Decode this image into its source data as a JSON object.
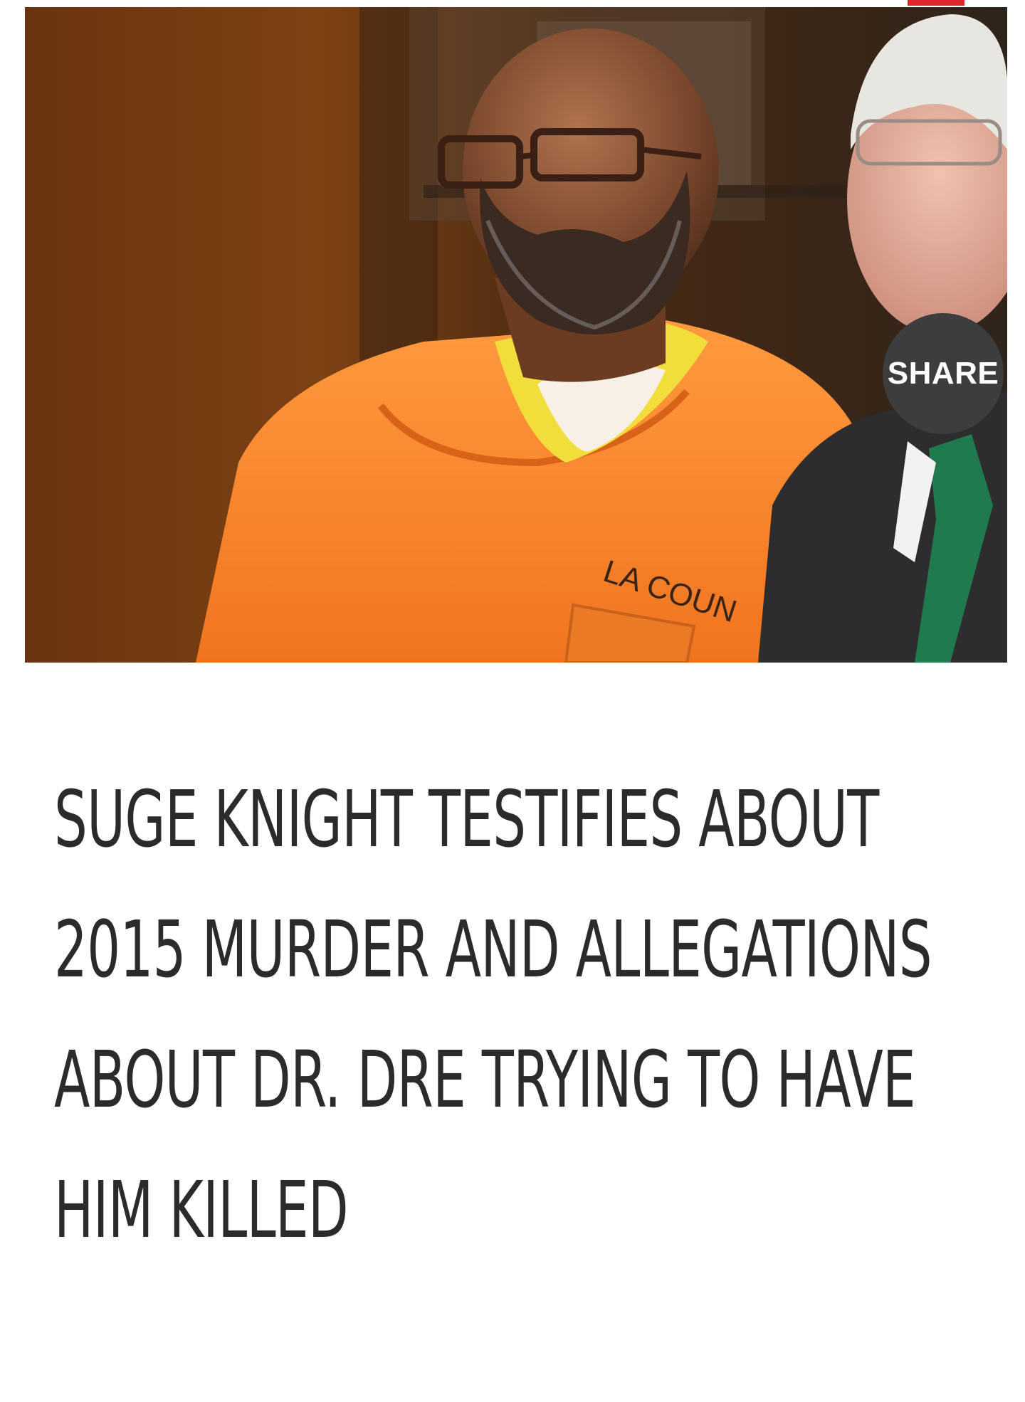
{
  "article": {
    "share_label": "SHARE",
    "headline": "SUGE KNIGHT TESTIFIES ABOUT 2015 MURDER AND ALLEGATIONS ABOUT DR. DRE TRYING TO HAVE HIM KILLED",
    "photo_text": "LA COUN"
  },
  "colors": {
    "accent": "#e0262d",
    "share_bg": "#3d3d3d",
    "headline": "#2b2b2b",
    "jumpsuit": "#f4822a"
  }
}
